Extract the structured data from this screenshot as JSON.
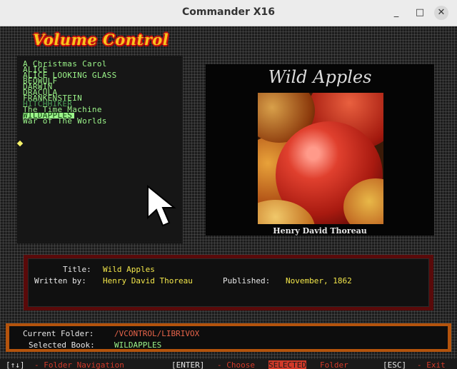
{
  "window": {
    "title": "Commander X16",
    "minimize_glyph": "_",
    "maximize_glyph": "□",
    "close_glyph": "✕"
  },
  "app": {
    "logo_text": "Volume Control"
  },
  "book_list": {
    "items": [
      {
        "label": "A Christmas Carol",
        "state": "normal"
      },
      {
        "label": "ALICE",
        "state": "normal"
      },
      {
        "label": "ALICE LOOKING GLASS",
        "state": "normal"
      },
      {
        "label": "BEOWULF",
        "state": "normal"
      },
      {
        "label": "DARWIN",
        "state": "normal"
      },
      {
        "label": "DRACULA",
        "state": "normal"
      },
      {
        "label": "FRANKENSTEIN",
        "state": "normal"
      },
      {
        "label": "HITCHHIKER",
        "state": "dim"
      },
      {
        "label": "The Time Machine",
        "state": "normal"
      },
      {
        "label": "WILDAPPLES",
        "state": "selected"
      },
      {
        "label": "War of The Worlds",
        "state": "normal"
      }
    ],
    "selected_index": 9
  },
  "cover": {
    "title": "Wild Apples",
    "author": "Henry David Thoreau"
  },
  "details": {
    "title_label": "Title:",
    "title_value": "Wild Apples",
    "author_label": "Written by:",
    "author_value": "Henry David Thoreau",
    "published_label": "Published:",
    "published_value": "November, 1862"
  },
  "status": {
    "folder_label": "Current Folder:",
    "folder_value": "/VCONTROL/LIBRIVOX",
    "book_label": "Selected Book:",
    "book_value": "WILDAPPLES"
  },
  "help": {
    "nav_key": "[↑↓]",
    "nav_desc": "- Folder Navigation",
    "enter_key": "[ENTER]",
    "enter_desc_1": "- Choose",
    "enter_desc_hl": "SELECTED",
    "enter_desc_2": "Folder",
    "esc_key": "[ESC]",
    "esc_desc": "- Exit"
  },
  "colors": {
    "list_text": "#9cf58a",
    "list_dim": "#4ea35a",
    "value_yellow": "#f2e64a",
    "folder_red": "#e8644a",
    "help_red": "#d23a2a",
    "info_border": "#5a0a0a",
    "folder_border": "#b4530c"
  }
}
